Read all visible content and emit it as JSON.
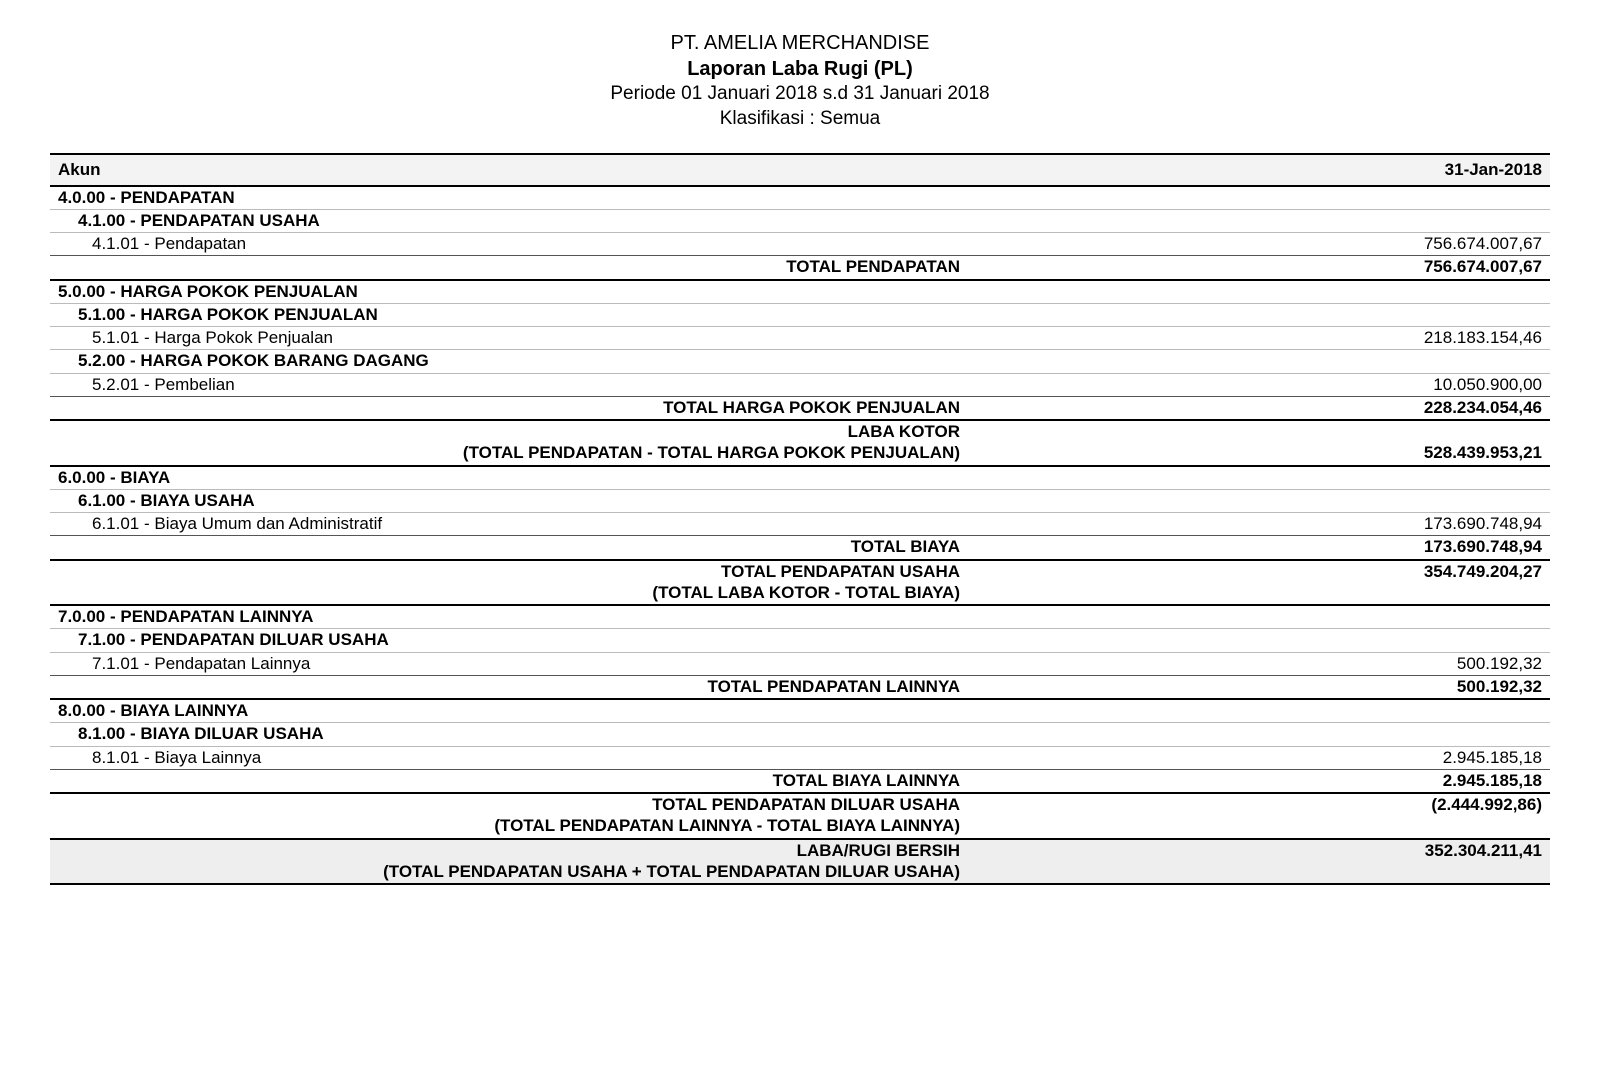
{
  "header": {
    "company": "PT. AMELIA MERCHANDISE",
    "title": "Laporan Laba Rugi (PL)",
    "period": "Periode 01 Januari 2018 s.d 31 Januari 2018",
    "classification": "Klasifikasi : Semua"
  },
  "columns": {
    "akun": "Akun",
    "date": "31-Jan-2018"
  },
  "rows": {
    "s4_0_00": "4.0.00 - PENDAPATAN",
    "s4_1_00": "4.1.00 - PENDAPATAN USAHA",
    "r4_1_01_label": "4.1.01 - Pendapatan",
    "r4_1_01_val": "756.674.007,67",
    "total_pendapatan_label": "TOTAL PENDAPATAN",
    "total_pendapatan_val": "756.674.007,67",
    "s5_0_00": "5.0.00 - HARGA POKOK PENJUALAN",
    "s5_1_00": "5.1.00 - HARGA POKOK PENJUALAN",
    "r5_1_01_label": "5.1.01 - Harga Pokok Penjualan",
    "r5_1_01_val": "218.183.154,46",
    "s5_2_00": "5.2.00 - HARGA POKOK BARANG DAGANG",
    "r5_2_01_label": "5.2.01 - Pembelian",
    "r5_2_01_val": "10.050.900,00",
    "total_hpp_label": "TOTAL HARGA POKOK PENJUALAN",
    "total_hpp_val": "228.234.054,46",
    "laba_kotor_line1": "LABA KOTOR",
    "laba_kotor_line2": "(TOTAL PENDAPATAN - TOTAL HARGA POKOK PENJUALAN)",
    "laba_kotor_val": "528.439.953,21",
    "s6_0_00": "6.0.00 - BIAYA",
    "s6_1_00": "6.1.00 - BIAYA USAHA",
    "r6_1_01_label": "6.1.01 - Biaya Umum dan Administratif",
    "r6_1_01_val": "173.690.748,94",
    "total_biaya_label": "TOTAL BIAYA",
    "total_biaya_val": "173.690.748,94",
    "total_pend_usaha_line1": "TOTAL PENDAPATAN USAHA",
    "total_pend_usaha_line2": "(TOTAL LABA KOTOR - TOTAL BIAYA)",
    "total_pend_usaha_val": "354.749.204,27",
    "s7_0_00": "7.0.00 - PENDAPATAN LAINNYA",
    "s7_1_00": "7.1.00 - PENDAPATAN DILUAR USAHA",
    "r7_1_01_label": "7.1.01 - Pendapatan Lainnya",
    "r7_1_01_val": "500.192,32",
    "total_pend_lain_label": "TOTAL PENDAPATAN LAINNYA",
    "total_pend_lain_val": "500.192,32",
    "s8_0_00": "8.0.00 - BIAYA LAINNYA",
    "s8_1_00": "8.1.00 - BIAYA DILUAR USAHA",
    "r8_1_01_label": "8.1.01 - Biaya Lainnya",
    "r8_1_01_val": "2.945.185,18",
    "total_biaya_lain_label": "TOTAL BIAYA LAINNYA",
    "total_biaya_lain_val": "2.945.185,18",
    "total_pend_diluar_line1": "TOTAL PENDAPATAN DILUAR USAHA",
    "total_pend_diluar_line2": "(TOTAL PENDAPATAN LAINNYA - TOTAL BIAYA LAINNYA)",
    "total_pend_diluar_val": "(2.444.992,86)",
    "labarugi_line1": "LABA/RUGI BERSIH",
    "labarugi_line2": "(TOTAL PENDAPATAN USAHA + TOTAL PENDAPATAN DILUAR USAHA)",
    "labarugi_val": "352.304.211,41"
  }
}
